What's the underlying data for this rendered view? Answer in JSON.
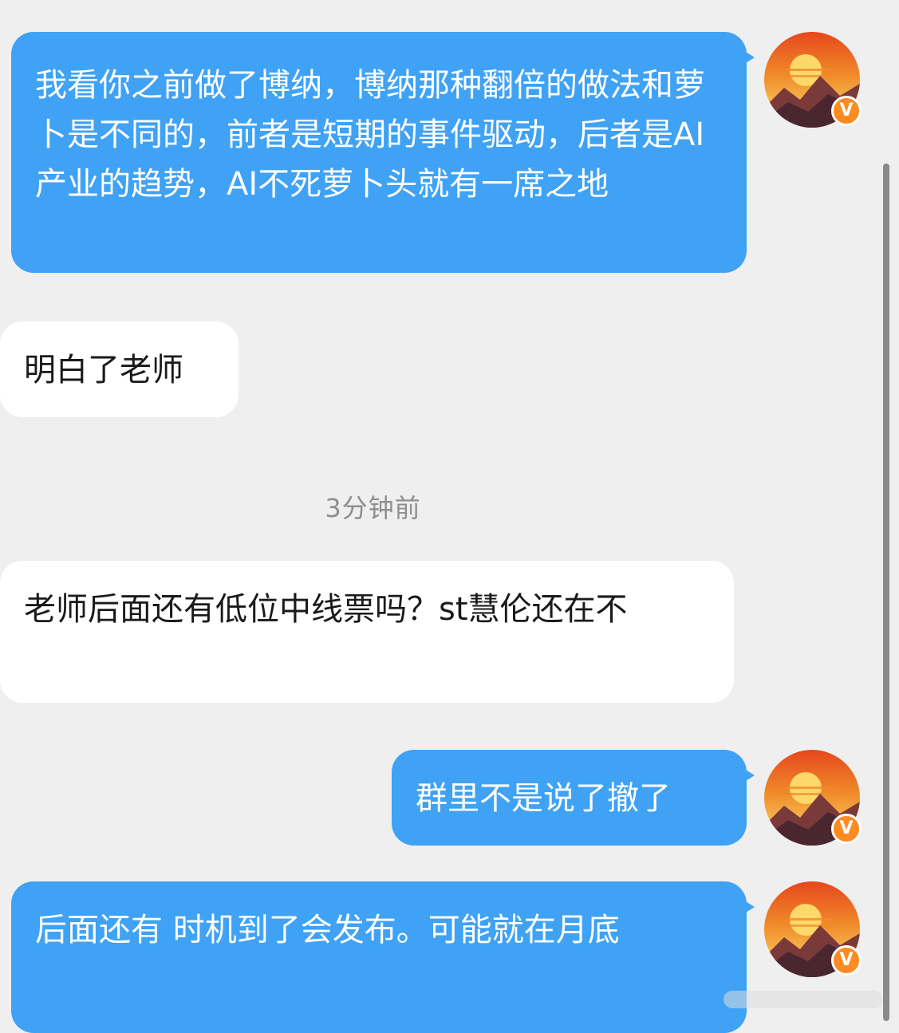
{
  "messages": [
    {
      "side": "out",
      "text": "我看你之前做了博纳，博纳那种翻倍的做法和萝卜是不同的，前者是短期的事件驱动，后者是AI产业的趋势，AI不死萝卜头就有一席之地"
    },
    {
      "side": "in",
      "text": "明白了老师"
    },
    {
      "side": "in",
      "text": "老师后面还有低位中线票吗？st慧伦还在不"
    },
    {
      "side": "out",
      "text": "群里不是说了撤了"
    },
    {
      "side": "out",
      "text": "后面还有 时机到了会发布。可能就在月底"
    }
  ],
  "timestamp": "3分钟前",
  "avatar": {
    "badge": "V",
    "badge_color": "#ff8a1f",
    "icon": "sunset-mountain-avatar"
  },
  "colors": {
    "outgoing_bubble": "#3fa2f5",
    "incoming_bubble": "#ffffff",
    "background": "#efefef"
  }
}
